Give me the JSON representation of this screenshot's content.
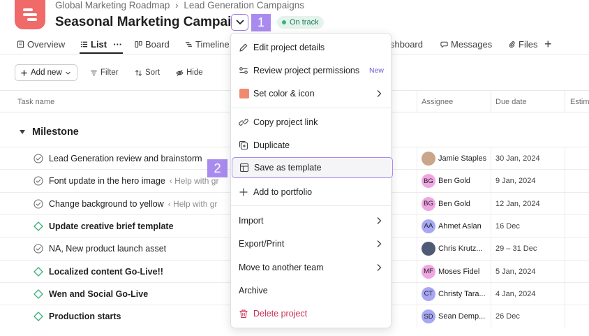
{
  "header": {
    "breadcrumb": [
      "Global Marketing Roadmap",
      "Lead Generation Campaigns"
    ],
    "breadcrumb_sep": "›",
    "title": "Seasonal Marketing Campaign",
    "status": "On track",
    "step_1": "1",
    "step_2": "2"
  },
  "tabs": [
    {
      "label": "Overview",
      "icon": "overview-icon"
    },
    {
      "label": "List",
      "icon": "list-icon",
      "active": true
    },
    {
      "label": "Board",
      "icon": "board-icon"
    },
    {
      "label": "Timeline",
      "icon": "timeline-icon"
    },
    {
      "label": "shboard",
      "icon": ""
    },
    {
      "label": "Messages",
      "icon": "message-icon"
    },
    {
      "label": "Files",
      "icon": "paperclip-icon"
    }
  ],
  "tabs_more": "···",
  "tabs_add": "+",
  "toolbar": {
    "add_new": "Add new",
    "filter": "Filter",
    "sort": "Sort",
    "hide": "Hide"
  },
  "table": {
    "columns": [
      "Task name",
      "Assignee",
      "Due date",
      "Estim"
    ],
    "section": "Milestone",
    "rows": [
      {
        "task": "Lead Generation review and brainstorm",
        "sub": "",
        "type": "check",
        "bold": false,
        "initials": "",
        "assignee": "Jamie Staples",
        "due": "30 Jan, 2024",
        "avatar_color": "#c9a58a"
      },
      {
        "task": "Font update in the hero image",
        "sub": "‹ Help with gr",
        "type": "check",
        "bold": false,
        "initials": "BG",
        "assignee": "Ben Gold",
        "due": "9 Jan, 2024",
        "avatar_color": "#f0a6e2"
      },
      {
        "task": "Change background to yellow",
        "sub": "‹ Help with gr",
        "type": "check",
        "bold": false,
        "initials": "BG",
        "assignee": "Ben Gold",
        "due": "12 Jan, 2024",
        "avatar_color": "#f0a6e2"
      },
      {
        "task": "Update creative brief template",
        "sub": "",
        "type": "milestone",
        "bold": true,
        "initials": "AA",
        "assignee": "Ahmet Aslan",
        "due": "16 Dec",
        "avatar_color": "#a8a7f3"
      },
      {
        "task": "NA, New product launch asset",
        "sub": "",
        "type": "check",
        "bold": false,
        "initials": "",
        "assignee": "Chris Krutz...",
        "due": "29 – 31 Dec",
        "avatar_color": "#4f5b75"
      },
      {
        "task": "Localized content Go-Live!!",
        "sub": "",
        "type": "milestone",
        "bold": true,
        "initials": "MF",
        "assignee": "Moses Fidel",
        "due": "5 Jan, 2024",
        "avatar_color": "#f0a6e2"
      },
      {
        "task": "Wen and Social Go-Live",
        "sub": "",
        "type": "milestone",
        "bold": true,
        "initials": "CT",
        "assignee": "Christy Tara...",
        "due": "4 Jan, 2024",
        "avatar_color": "#a8a7f3"
      },
      {
        "task": "Production starts",
        "sub": "",
        "type": "milestone",
        "bold": true,
        "initials": "SD",
        "assignee": "Sean Demp...",
        "due": "26 Dec",
        "avatar_color": "#a8a7f3"
      }
    ]
  },
  "menu": {
    "items": [
      {
        "label": "Edit project details",
        "icon": "pencil-icon"
      },
      {
        "label": "Review project permissions",
        "icon": "permissions-icon",
        "badge": "New"
      },
      {
        "label": "Set color & icon",
        "icon": "color-swatch",
        "submenu": true,
        "swatch": "#ef8a6f"
      },
      {
        "label": "Copy project link",
        "icon": "link-icon"
      },
      {
        "label": "Duplicate",
        "icon": "duplicate-icon"
      },
      {
        "label": "Save as template",
        "icon": "template-icon",
        "highlighted": true
      },
      {
        "label": "Add to portfolio",
        "icon": "plus-icon"
      },
      {
        "label": "Import",
        "submenu": true
      },
      {
        "label": "Export/Print",
        "submenu": true
      },
      {
        "label": "Move to another team",
        "submenu": true
      },
      {
        "label": "Archive"
      },
      {
        "label": "Delete project",
        "icon": "trash-icon",
        "danger": true
      }
    ]
  },
  "colors": {
    "accent": "#a98bf0",
    "logo": "#f06a6a",
    "status_bg": "#e4f3ec",
    "status_text": "#1d7a55",
    "danger": "#c92f54",
    "milestone": "#3bb07a"
  }
}
